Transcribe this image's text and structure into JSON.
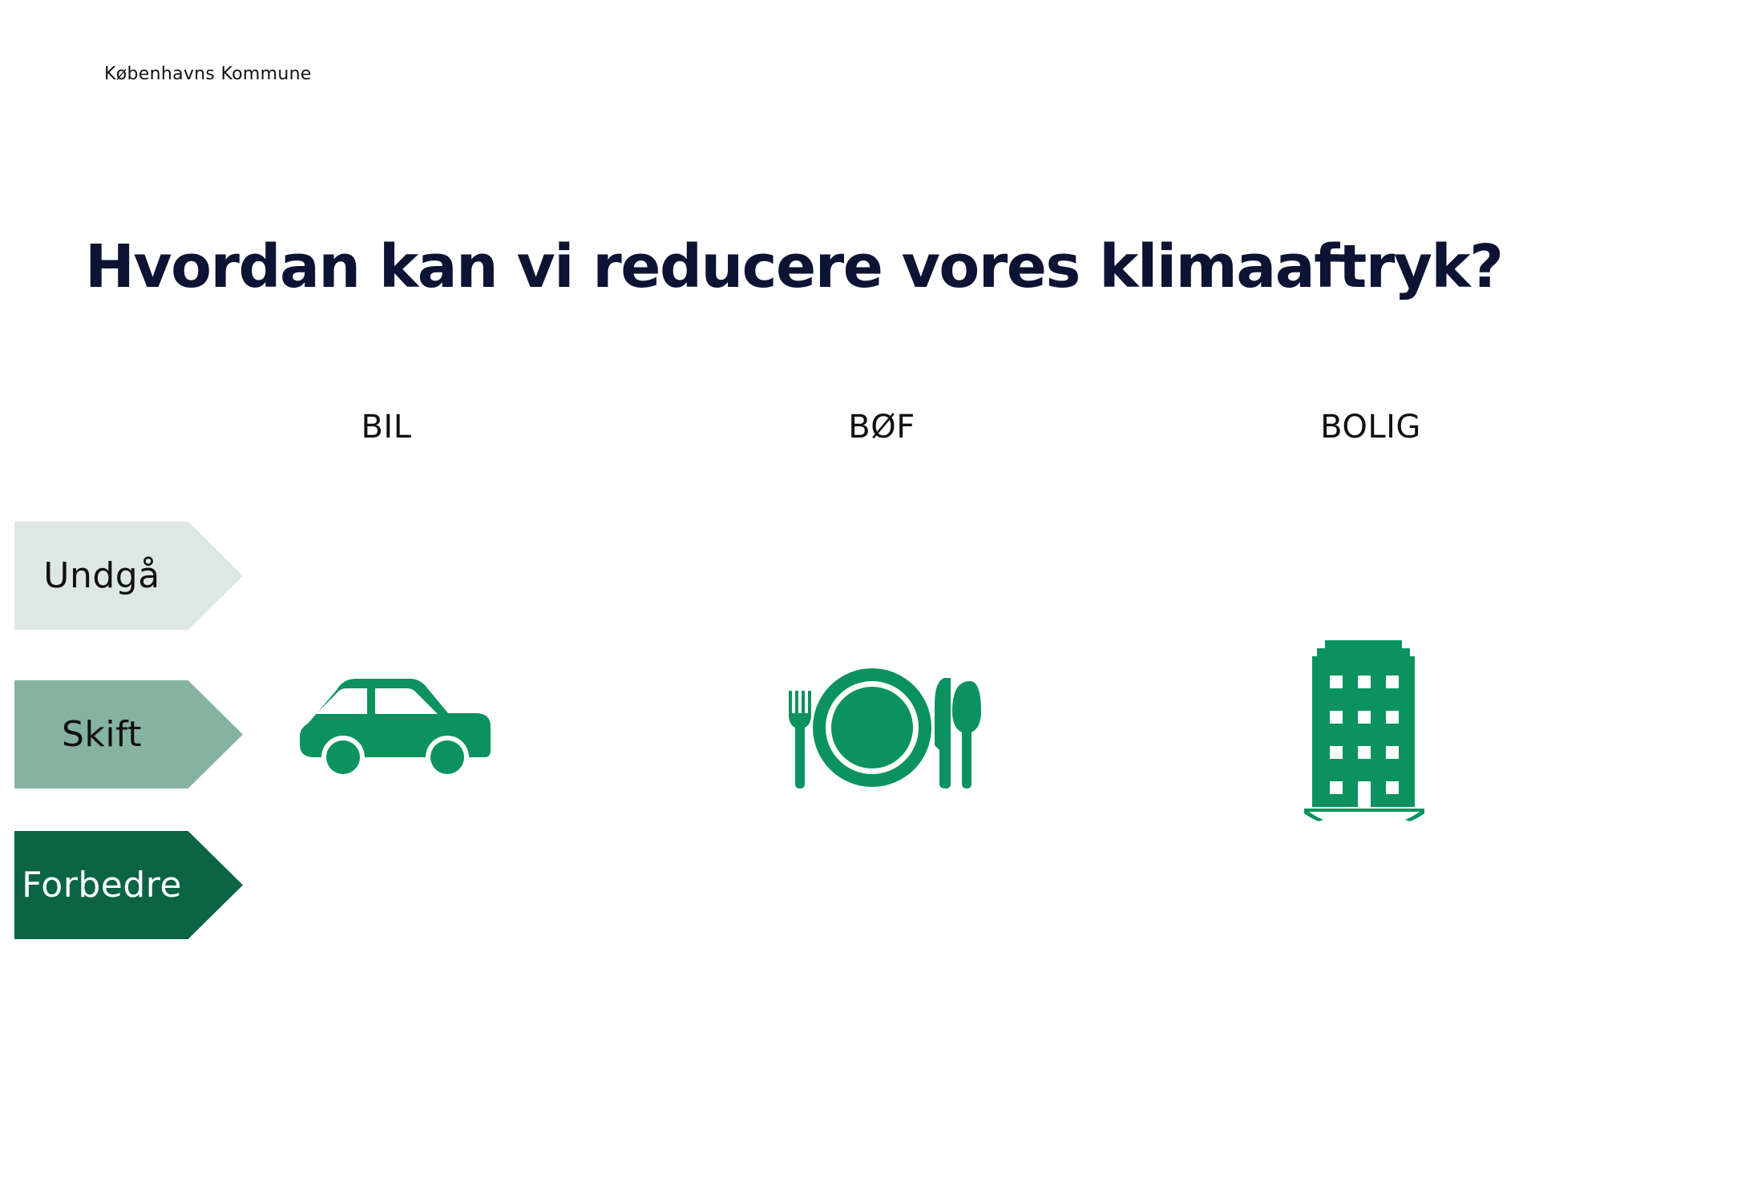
{
  "header": {
    "organization": "Københavns Kommune"
  },
  "title": "Hvordan kan vi reducere vores klimaaftryk?",
  "columns": [
    {
      "label": "BIL",
      "icon": "car-icon"
    },
    {
      "label": "BØF",
      "icon": "plate-cutlery-icon"
    },
    {
      "label": "BOLIG",
      "icon": "building-icon"
    }
  ],
  "steps": [
    {
      "label": "Undgå",
      "color": "#dde8e4",
      "text_color": "#111111"
    },
    {
      "label": "Skift",
      "color": "#86b3a1",
      "text_color": "#111111"
    },
    {
      "label": "Forbedre",
      "color": "#0b6443",
      "text_color": "#ffffff"
    }
  ],
  "colors": {
    "icon_green": "#0c925e",
    "title": "#0d1333"
  }
}
